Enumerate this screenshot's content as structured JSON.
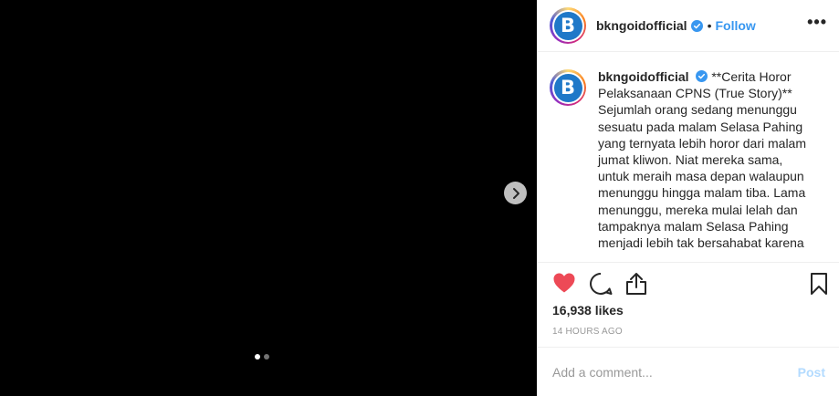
{
  "post": {
    "username": "bkngoidofficial",
    "follow_label": "Follow",
    "separator": "•",
    "more_label": "•••",
    "caption": "**Cerita Horor Pelaksanaan CPNS (True Story)** Sejumlah orang sedang menunggu sesuatu pada malam Selasa Pahing yang ternyata lebih horor dari malam jumat kliwon. Niat mereka sama, untuk meraih masa depan walaupun menunggu hingga malam tiba. Lama menunggu, mereka mulai lelah dan tampaknya malam Selasa Pahing menjadi lebih tak bersahabat karena",
    "likes": "16,938 likes",
    "timestamp": "14 HOURS AGO",
    "avatar_letter": "B",
    "liked": true
  },
  "comment": {
    "placeholder": "Add a comment...",
    "post_label": "Post"
  },
  "carousel": {
    "slide_count": 2,
    "active_index": 0
  },
  "icons": {
    "heart": "heart-filled-icon",
    "comment": "comment-icon",
    "share": "share-icon",
    "save": "bookmark-icon",
    "verified": "verified-badge-icon",
    "next": "chevron-right-icon"
  },
  "colors": {
    "heart": "#ed4956",
    "link": "#3897f0",
    "verified": "#3897f0",
    "post_disabled": "#b3dbff"
  }
}
